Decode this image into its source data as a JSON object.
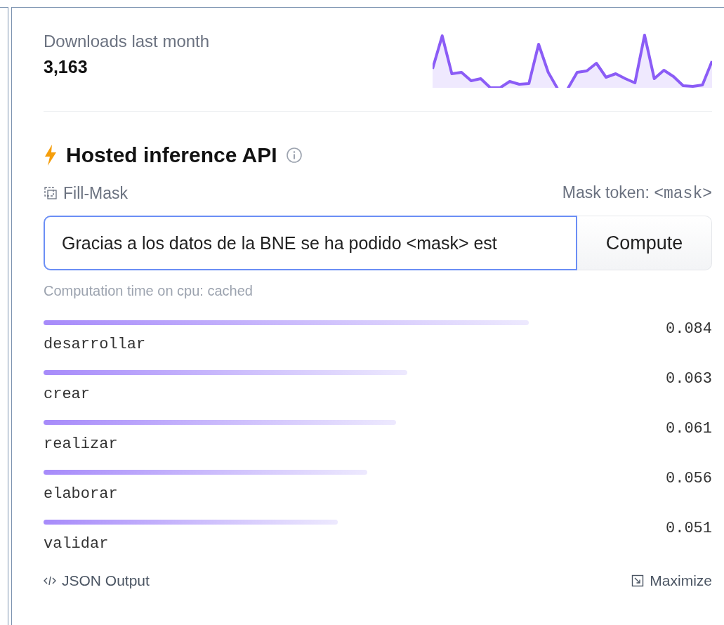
{
  "downloads": {
    "label": "Downloads last month",
    "count": "3,163"
  },
  "inference": {
    "title": "Hosted inference API",
    "task": "Fill-Mask",
    "mask_token_label": "Mask token:",
    "mask_token": "<mask>",
    "input_value": "Gracias a los datos de la BNE se ha podido <mask> est",
    "button": "Compute",
    "computation": "Computation time on cpu: cached",
    "results": [
      {
        "token": "desarrollar",
        "score": "0.084"
      },
      {
        "token": "crear",
        "score": "0.063"
      },
      {
        "token": "realizar",
        "score": "0.061"
      },
      {
        "token": "elaborar",
        "score": "0.056"
      },
      {
        "token": "validar",
        "score": "0.051"
      }
    ],
    "json_output": "JSON Output",
    "maximize": "Maximize"
  }
}
